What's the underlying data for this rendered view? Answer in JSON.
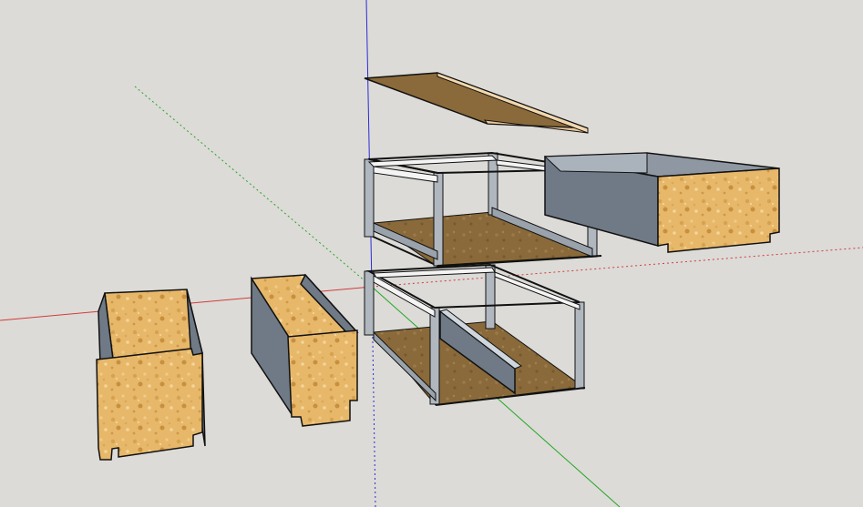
{
  "viewport": {
    "background": "#dcdbd7"
  },
  "colors": {
    "axis_red": "#d23b3b",
    "axis_green": "#26a626",
    "axis_blue": "#2b2bd9",
    "osb_light": "#e7b86a",
    "osb_dark": "#c88f3e",
    "wood_floor": "#8a6a3a",
    "panel_gray": "#6f7a86",
    "panel_light": "#cfd6de",
    "edge": "#111111"
  },
  "icons": {
    "origin": "axis-origin-icon"
  }
}
